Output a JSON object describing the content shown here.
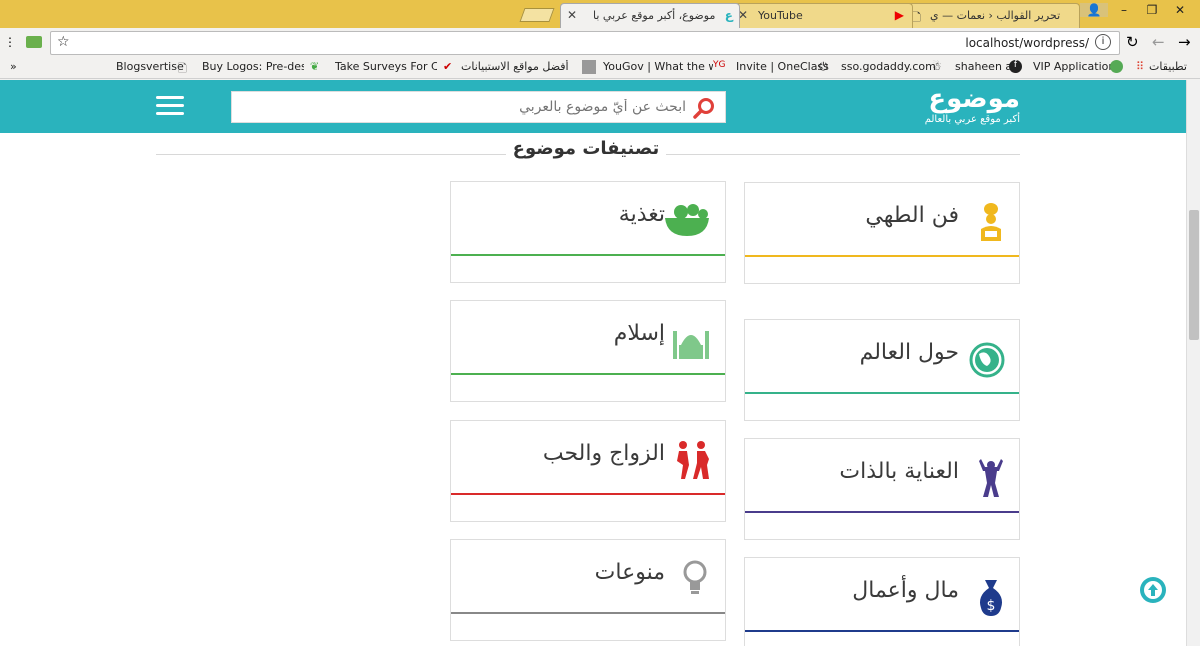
{
  "browser": {
    "tabs": [
      {
        "title": "تحرير القوالب ‹ نعمات — ي",
        "active": false
      },
      {
        "title": "YouTube",
        "active": false
      },
      {
        "title": "موضوع، أكبر موقع عربي با",
        "active": true
      }
    ],
    "url": "localhost/wordpress/",
    "bookmarks": [
      "Blogsvertise",
      "Buy Logos: Pre-design",
      "Take Surveys For Cash",
      "أفضل مواقع الاستبيانات",
      "YouGov | What the wo",
      "Invite | OneClass",
      "sso.godaddy.com",
      "shaheen a",
      "VIP Application",
      "تطبيقات"
    ],
    "overflow": "»"
  },
  "site": {
    "logo": "موضوع",
    "tagline": "أكبر موقع عربي بالعالم",
    "search_placeholder": "ابحث عن أيّ موضوع بالعربي",
    "section_title": "تصنيفات موضوع",
    "categories": [
      {
        "title": "فن الطهي",
        "icon": "chef-icon",
        "color": "#f0b81e"
      },
      {
        "title": "تغذية",
        "icon": "fruit-basket-icon",
        "color": "#4cb050"
      },
      {
        "title": "حول العالم",
        "icon": "globe-icon",
        "color": "#35b28a"
      },
      {
        "title": "إسلام",
        "icon": "mosque-icon",
        "color": "#4cb050"
      },
      {
        "title": "العناية بالذات",
        "icon": "bodybuilder-icon",
        "color": "#4a3c8c"
      },
      {
        "title": "الزواج والحب",
        "icon": "couple-icon",
        "color": "#d92a2a"
      },
      {
        "title": "مال وأعمال",
        "icon": "money-bag-icon",
        "color": "#1f3b8c"
      },
      {
        "title": "منوعات",
        "icon": "lightbulb-icon",
        "color": "#888888"
      }
    ]
  }
}
